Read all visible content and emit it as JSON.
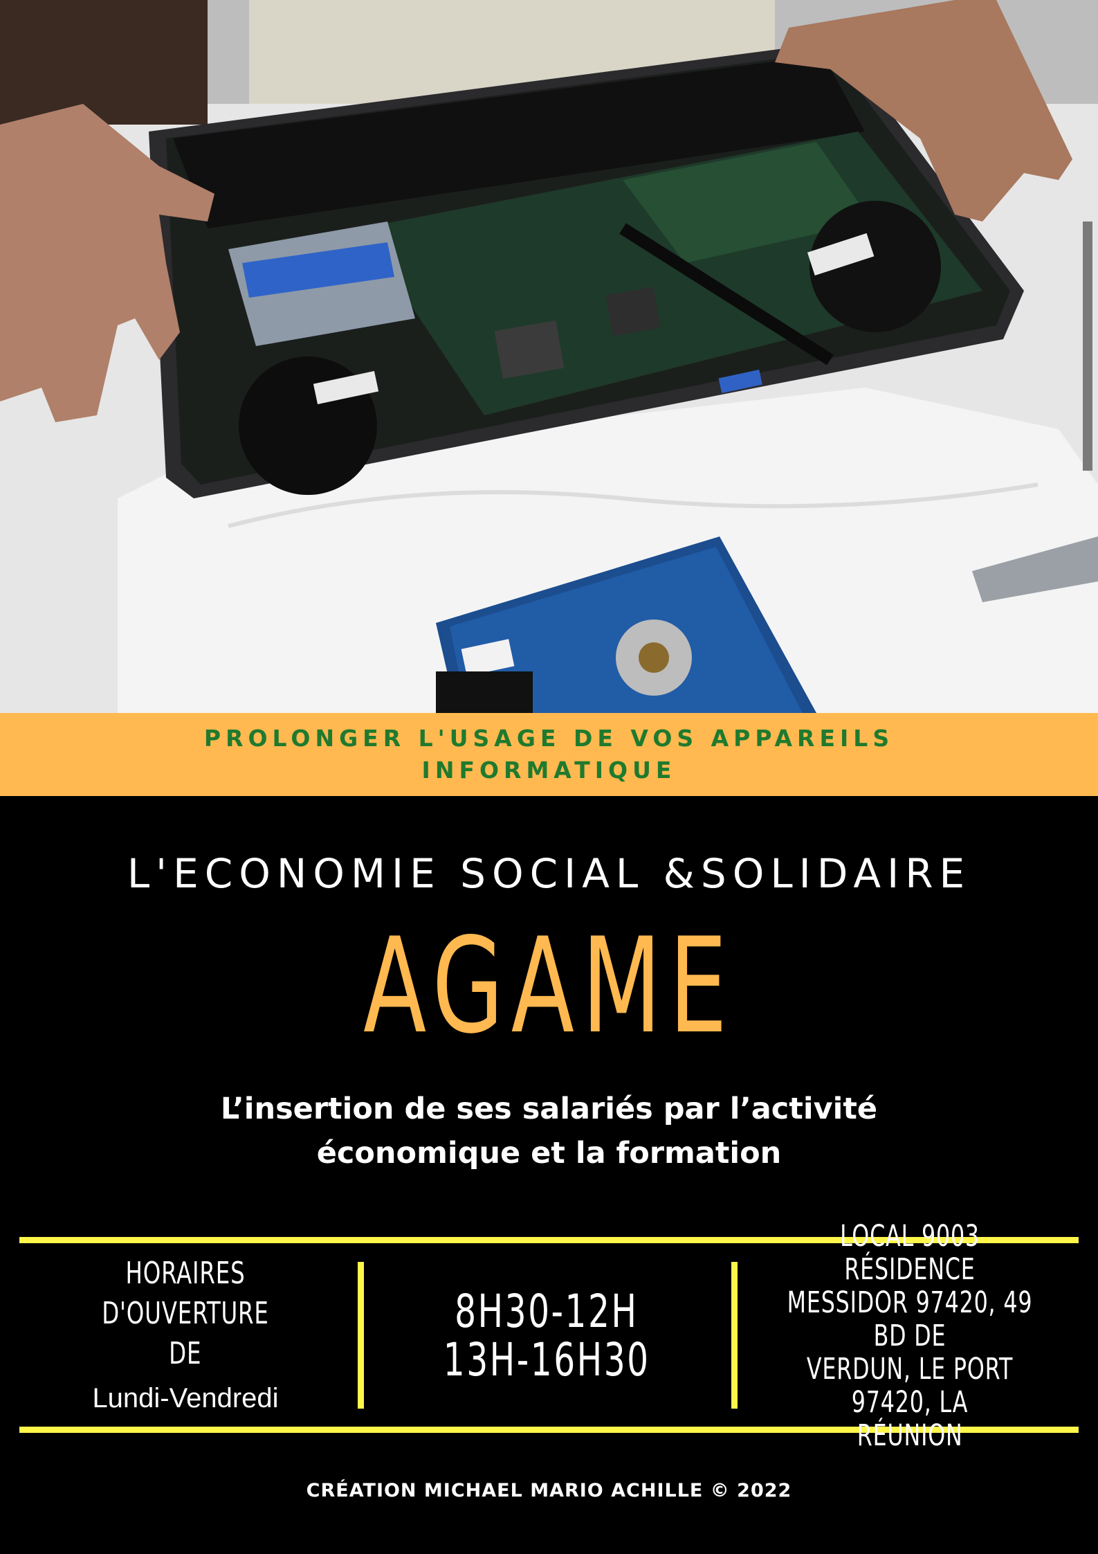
{
  "banner": {
    "line1": "PROLONGER L'USAGE DE VOS APPAREILS",
    "line2": "INFORMATIQUE"
  },
  "subtitle": "L'ECONOMIE SOCIAL &SOLIDAIRE",
  "title": "AGAME",
  "tagline": {
    "line1": "L’insertion de ses salariés par l’activité",
    "line2": "économique et la formation"
  },
  "info": {
    "hours_label_line1": "HORAIRES D'OUVERTURE",
    "hours_label_line2": "DE",
    "days": "Lundi-Vendredi",
    "time_morning": "8H30-12H",
    "time_afternoon": "13H-16H30",
    "address_line1": "LOCAL 9003 RÉSIDENCE",
    "address_line2": "MESSIDOR 97420, 49 BD DE",
    "address_line3": "VERDUN, LE PORT 97420, LA",
    "address_line4": "RÉUNION"
  },
  "credit": "CRÉATION MICHAEL MARIO ACHILLE © 2022",
  "colors": {
    "accent_orange": "#ffb950",
    "banner_text_green": "#1f7a2e",
    "rule_yellow": "#fff64a",
    "background": "#000000"
  },
  "photo": {
    "icons": [
      "laptop-motherboard",
      "hard-drive",
      "hands"
    ]
  }
}
